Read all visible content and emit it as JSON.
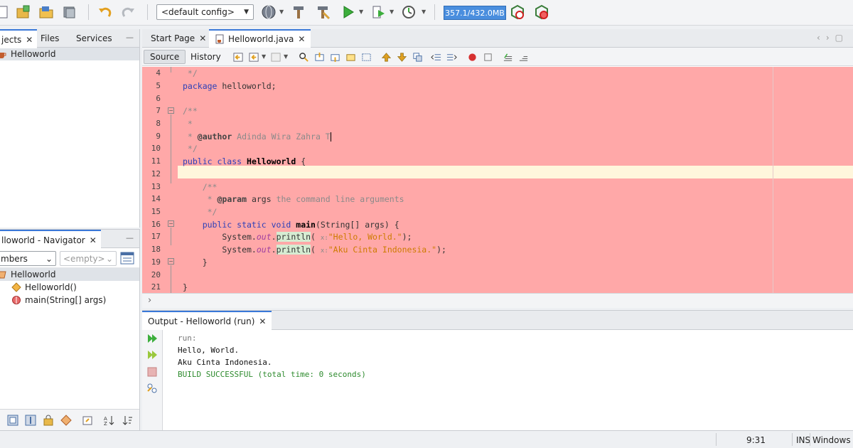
{
  "toolbar": {
    "config": "<default config>",
    "memory": "357.1/432.0MB"
  },
  "projects_panel": {
    "tabs": [
      "jects",
      "Files",
      "Services"
    ],
    "tab_close": "✕",
    "minimize": "—",
    "tree": [
      "Helloworld"
    ]
  },
  "navigator_panel": {
    "title": "lloworld - Navigator",
    "close": "✕",
    "minimize": "—",
    "filter_value": "mbers",
    "empty_value": "<empty>",
    "tree": [
      "Helloworld",
      "Helloworld()",
      "main(String[] args)"
    ]
  },
  "editor": {
    "tabs": [
      "Start Page",
      "Helloworld.java"
    ],
    "tab_close": "✕",
    "modes": [
      "Source",
      "History"
    ],
    "line_numbers": [
      "4",
      "5",
      "6",
      "7",
      "8",
      "9",
      "10",
      "11",
      "12",
      "13",
      "14",
      "15",
      "16",
      "17",
      "18",
      "19",
      "20",
      "21"
    ],
    "code": {
      "l4": " */",
      "l5_kw": "package",
      "l5_rest": " helloworld;",
      "l7": "/**",
      "l8": " *",
      "l9_pre": " * ",
      "l9_tag": "@author",
      "l9_rest": " Adinda Wira Zahra T",
      "l10": " */",
      "l11_kw": "public class",
      "l11_name": "Helloworld",
      "l11_rest": " {",
      "l13": "    /**",
      "l14_pre": "     * ",
      "l14_tag": "@param",
      "l14_arg": " args",
      "l14_rest": " the command line arguments",
      "l15": "     */",
      "l16_kw": "    public static void",
      "l16_name": "main",
      "l16_rest": "(String[] args) {",
      "l17_pre": "        System.",
      "l17_field": "out",
      "l17_dot": ".",
      "l17_method": "println",
      "l17_open": "( ",
      "l17_hint": "x:",
      "l17_str": "\"Hello, World.\"",
      "l17_end": ");",
      "l18_pre": "        System.",
      "l18_field": "out",
      "l18_dot": ".",
      "l18_method": "println",
      "l18_open": "( ",
      "l18_hint": "x:",
      "l18_str": "\"Aku Cinta Indonesia.\"",
      "l18_end": ");",
      "l19": "    }",
      "l21": "}"
    }
  },
  "output": {
    "tab": "Output - Helloworld (run)",
    "close": "✕",
    "lines": [
      "run:",
      "Hello, World.",
      "Aku Cinta Indonesia.",
      "BUILD SUCCESSFUL (total time: 0 seconds)"
    ]
  },
  "statusbar": {
    "position": "9:31",
    "mode": "INS",
    "line_ending": "Windows (C"
  },
  "colors": {
    "editor_background": "#ffa8a8",
    "current_line": "#fff6dc",
    "keyword": "#2c3fb8",
    "string": "#ce7b00",
    "build_success": "#2e8b2e",
    "memory_bar": "#4a8ede"
  }
}
